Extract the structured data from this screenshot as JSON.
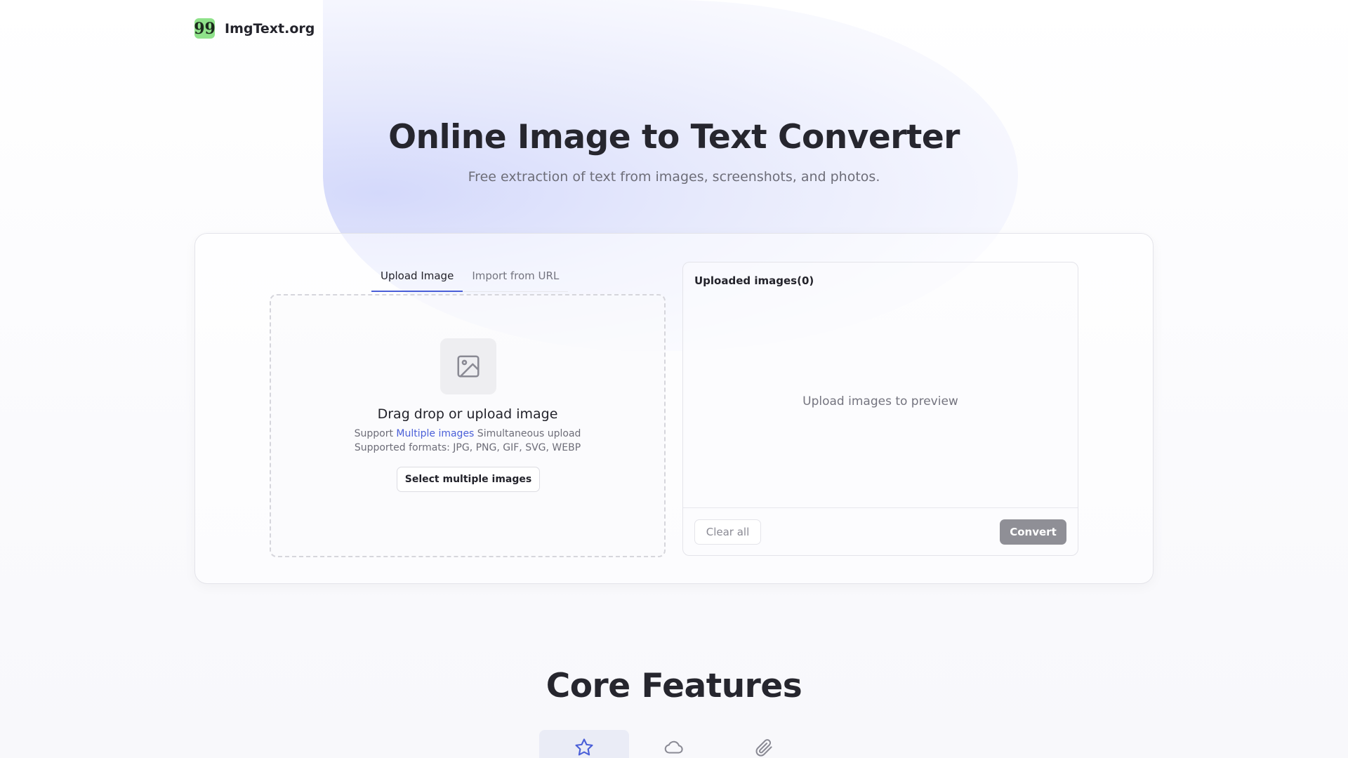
{
  "brand": {
    "logo_glyph": "99",
    "name": "ImgText.org",
    "logo_color": "#8fe28a"
  },
  "hero": {
    "title": "Online Image to Text Converter",
    "subtitle": "Free extraction of text from images, screenshots, and photos."
  },
  "upload": {
    "tabs": [
      {
        "label": "Upload Image",
        "active": true
      },
      {
        "label": "Import from URL",
        "active": false
      }
    ],
    "dropzone": {
      "icon": "image-icon",
      "title": "Drag drop or upload image",
      "support_prefix": "Support ",
      "support_highlight": "Multiple images",
      "support_suffix": " Simultaneous upload",
      "formats": "Supported formats: JPG, PNG, GIF, SVG, WEBP",
      "button": "Select multiple images"
    }
  },
  "preview": {
    "title": "Uploaded images(0)",
    "empty_text": "Upload images to preview",
    "clear_label": "Clear all",
    "convert_label": "Convert"
  },
  "features": {
    "title": "Core Features",
    "tabs": [
      {
        "icon": "star-icon",
        "active": true
      },
      {
        "icon": "cloud-icon",
        "active": false
      },
      {
        "icon": "paperclip-icon",
        "active": false
      }
    ]
  },
  "colors": {
    "accent": "#4a5fd8",
    "convert_disabled": "#8f8f96"
  }
}
